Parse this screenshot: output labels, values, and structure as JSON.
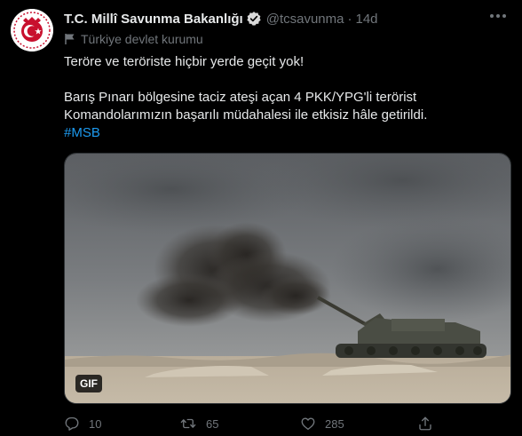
{
  "tweet": {
    "author_name": "T.C. Millî Savunma Bakanlığı",
    "handle": "@tcsavunma",
    "separator": "·",
    "time": "14d",
    "label": "Türkiye devlet kurumu",
    "line1": "Teröre ve teröriste hiçbir yerde geçit yok!",
    "line2": "Barış Pınarı bölgesine taciz ateşi açan 4 PKK/YPG'li terörist",
    "line3": "Komandolarımızın başarılı müdahalesi ile etkisiz hâle getirildi.",
    "hashtag": "#MSB",
    "media_badge": "GIF"
  },
  "actions": {
    "replies": "10",
    "retweets": "65",
    "likes": "285"
  },
  "colors": {
    "background": "#000000",
    "text": "#e7e9ea",
    "muted": "#71767b",
    "accent": "#1d9bf0",
    "avatar_red": "#c8102e"
  }
}
